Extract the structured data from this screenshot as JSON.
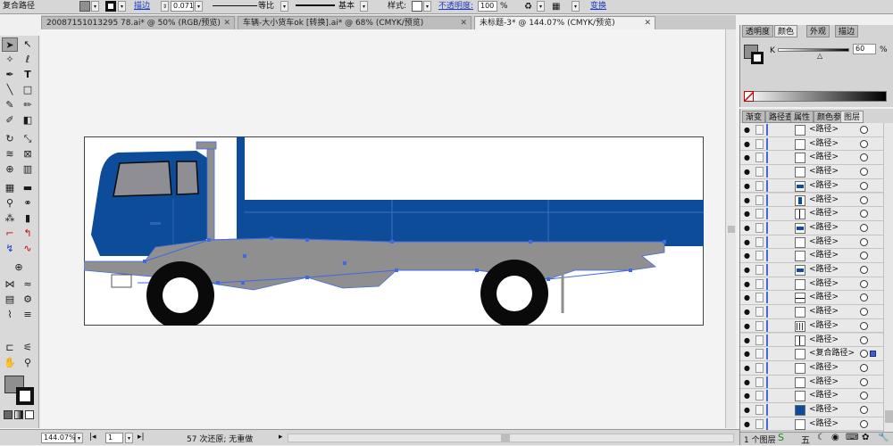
{
  "control_bar": {
    "selection_label": "复合路径",
    "stroke_label": "描边",
    "stroke_width": "0.071",
    "profile_label": "等比",
    "brush_label": "基本",
    "style_label": "样式:",
    "opacity_label": "不透明度:",
    "opacity_value": "100",
    "percent": "%",
    "transform_label": "变换"
  },
  "tabs": [
    {
      "label": "20087151013295 78.ai* @ 50% (RGB/预览)",
      "close": "✕"
    },
    {
      "label": "车辆-大小货车ok [转换].ai* @ 68% (CMYK/预览)",
      "close": "✕"
    },
    {
      "label": "未标题-3* @ 144.07% (CMYK/预览)",
      "close": "✕"
    }
  ],
  "color_panel": {
    "tabs": [
      "透明度",
      "颜色",
      "外观",
      "描边"
    ],
    "channel": "K",
    "value": "60",
    "percent": "%"
  },
  "layers_panel": {
    "tabs": [
      "渐变",
      "路径查",
      "属性",
      "颜色参",
      "图层"
    ],
    "rows": [
      {
        "name": "<路径>",
        "thumb": "plain"
      },
      {
        "name": "<路径>",
        "thumb": "plain"
      },
      {
        "name": "<路径>",
        "thumb": "plain"
      },
      {
        "name": "<路径>",
        "thumb": "plain"
      },
      {
        "name": "<路径>",
        "thumb": "blue-h"
      },
      {
        "name": "<路径>",
        "thumb": "blue-v"
      },
      {
        "name": "<路径>",
        "thumb": "line-v"
      },
      {
        "name": "<路径>",
        "thumb": "blue-h"
      },
      {
        "name": "<路径>",
        "thumb": "plain"
      },
      {
        "name": "<路径>",
        "thumb": "plain"
      },
      {
        "name": "<路径>",
        "thumb": "blue-h"
      },
      {
        "name": "<路径>",
        "thumb": "plain"
      },
      {
        "name": "<路径>",
        "thumb": "line-h"
      },
      {
        "name": "<路径>",
        "thumb": "plain"
      },
      {
        "name": "<路径>",
        "thumb": "stripes"
      },
      {
        "name": "<路径>",
        "thumb": "line-v"
      },
      {
        "name": "<复合路径>",
        "thumb": "plain",
        "selected": true
      },
      {
        "name": "<路径>",
        "thumb": "plain"
      },
      {
        "name": "<路径>",
        "thumb": "plain"
      },
      {
        "name": "<路径>",
        "thumb": "plain"
      },
      {
        "name": "<路径>",
        "thumb": "blue"
      },
      {
        "name": "<路径>",
        "thumb": "plain"
      }
    ],
    "footer": "1 个图层"
  },
  "status": {
    "zoom": "144.07%",
    "page": "1",
    "message": "57 次还原; 无重做"
  },
  "colors": {
    "truck_blue": "#0d4c98",
    "chassis_gray": "#8f8f8f",
    "tire_black": "#0a0a0a",
    "selection_blue": "#4169e1"
  },
  "watermark": "五"
}
